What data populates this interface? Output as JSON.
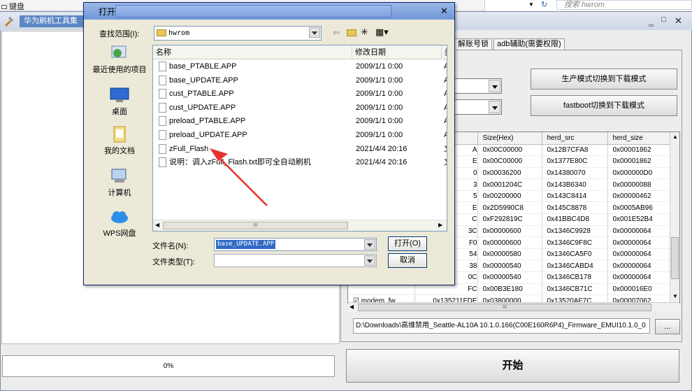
{
  "top_strip": {
    "keyboard_label": "键盘",
    "search_placeholder": "搜索 hwrom"
  },
  "main_window": {
    "title": "华为刷机工具集",
    "tabs": [
      "解账号锁",
      "adb辅助(需要权限)"
    ],
    "buttons": {
      "mode_switch": "生产模式切换到下载模式",
      "fastboot_switch": "fastboot切换到下载模式",
      "browse": "...",
      "start": "开始"
    },
    "grid": {
      "headers": [
        "",
        "",
        "Size(Hex)",
        "herd_src",
        "herd_size"
      ],
      "rows": [
        {
          "name": "",
          "addr": "A",
          "size": "0x00C00000",
          "src": "0x12B7CFA8",
          "hsize": "0x00001862"
        },
        {
          "name": "",
          "addr": "E",
          "size": "0x00C00000",
          "src": "0x1377E80C",
          "hsize": "0x00001862"
        },
        {
          "name": "",
          "addr": "0",
          "size": "0x00036200",
          "src": "0x14380070",
          "hsize": "0x000000D0"
        },
        {
          "name": "",
          "addr": "3",
          "size": "0x0001204C",
          "src": "0x143B6340",
          "hsize": "0x00000088"
        },
        {
          "name": "",
          "addr": "5",
          "size": "0x00200000",
          "src": "0x143C8414",
          "hsize": "0x00000462"
        },
        {
          "name": "",
          "addr": "E",
          "size": "0x2D5990C8",
          "src": "0x145C8878",
          "hsize": "0x0005AB96"
        },
        {
          "name": "",
          "addr": "C",
          "size": "0xF292819C",
          "src": "0x41BBC4D8",
          "hsize": "0x001E52B4"
        },
        {
          "name": "",
          "addr": "3C",
          "size": "0x00000600",
          "src": "0x1346C9928",
          "hsize": "0x00000064"
        },
        {
          "name": "",
          "addr": "F0",
          "size": "0x00000600",
          "src": "0x1346C9F8C",
          "hsize": "0x00000064"
        },
        {
          "name": "",
          "addr": "54",
          "size": "0x00000580",
          "src": "0x1346CA5F0",
          "hsize": "0x00000064"
        },
        {
          "name": "",
          "addr": "38",
          "size": "0x00000540",
          "src": "0x1346CABD4",
          "hsize": "0x00000064"
        },
        {
          "name": "",
          "addr": "0C",
          "size": "0x00000540",
          "src": "0x1346CB178",
          "hsize": "0x00000064"
        },
        {
          "name": "",
          "addr": "FC",
          "size": "0x00B3E180",
          "src": "0x1346CB71C",
          "hsize": "0x000016E0"
        },
        {
          "name": "modem_fw",
          "addr": "0x135211FDE",
          "size": "0x03800000",
          "src": "0x13520AF7C",
          "hsize": "0x00007062"
        }
      ],
      "hscroll_thumb": "III"
    },
    "path": "D:\\Downloads\\高维禁用_Seattle-AL10A 10.1.0.166(C00E160R6P4)_Firmware_EMUI10.1.0_0",
    "progress": {
      "percent_label": "0%",
      "value": 0
    }
  },
  "open_dialog": {
    "title": "打开",
    "look_in_label": "查找范围(I):",
    "look_in_value": "hwrom",
    "places": [
      "最近使用的项目",
      "桌面",
      "我的文档",
      "计算机",
      "WPS网盘"
    ],
    "columns": {
      "name": "名称",
      "date": "修改日期",
      "type": "类"
    },
    "files": [
      {
        "name": "base_PTABLE.APP",
        "date": "2009/1/1 0:00",
        "type": "A"
      },
      {
        "name": "base_UPDATE.APP",
        "date": "2009/1/1 0:00",
        "type": "A"
      },
      {
        "name": "cust_PTABLE.APP",
        "date": "2009/1/1 0:00",
        "type": "A"
      },
      {
        "name": "cust_UPDATE.APP",
        "date": "2009/1/1 0:00",
        "type": "A"
      },
      {
        "name": "preload_PTABLE.APP",
        "date": "2009/1/1 0:00",
        "type": "A"
      },
      {
        "name": "preload_UPDATE.APP",
        "date": "2009/1/1 0:00",
        "type": "A"
      },
      {
        "name": "zFull_Flash",
        "date": "2021/4/4 20:16",
        "type": "文"
      },
      {
        "name": "说明：调入zFull_Flash.txt即可全自动刷机",
        "date": "2021/4/4 20:16",
        "type": "文"
      }
    ],
    "scroll_thumb": "III",
    "filename_label": "文件名(N):",
    "filename_value": "base_UPDATE.APP",
    "filetype_label": "文件类型(T):",
    "filetype_value": "",
    "open_button": "打开(O)",
    "cancel_button": "取消"
  }
}
